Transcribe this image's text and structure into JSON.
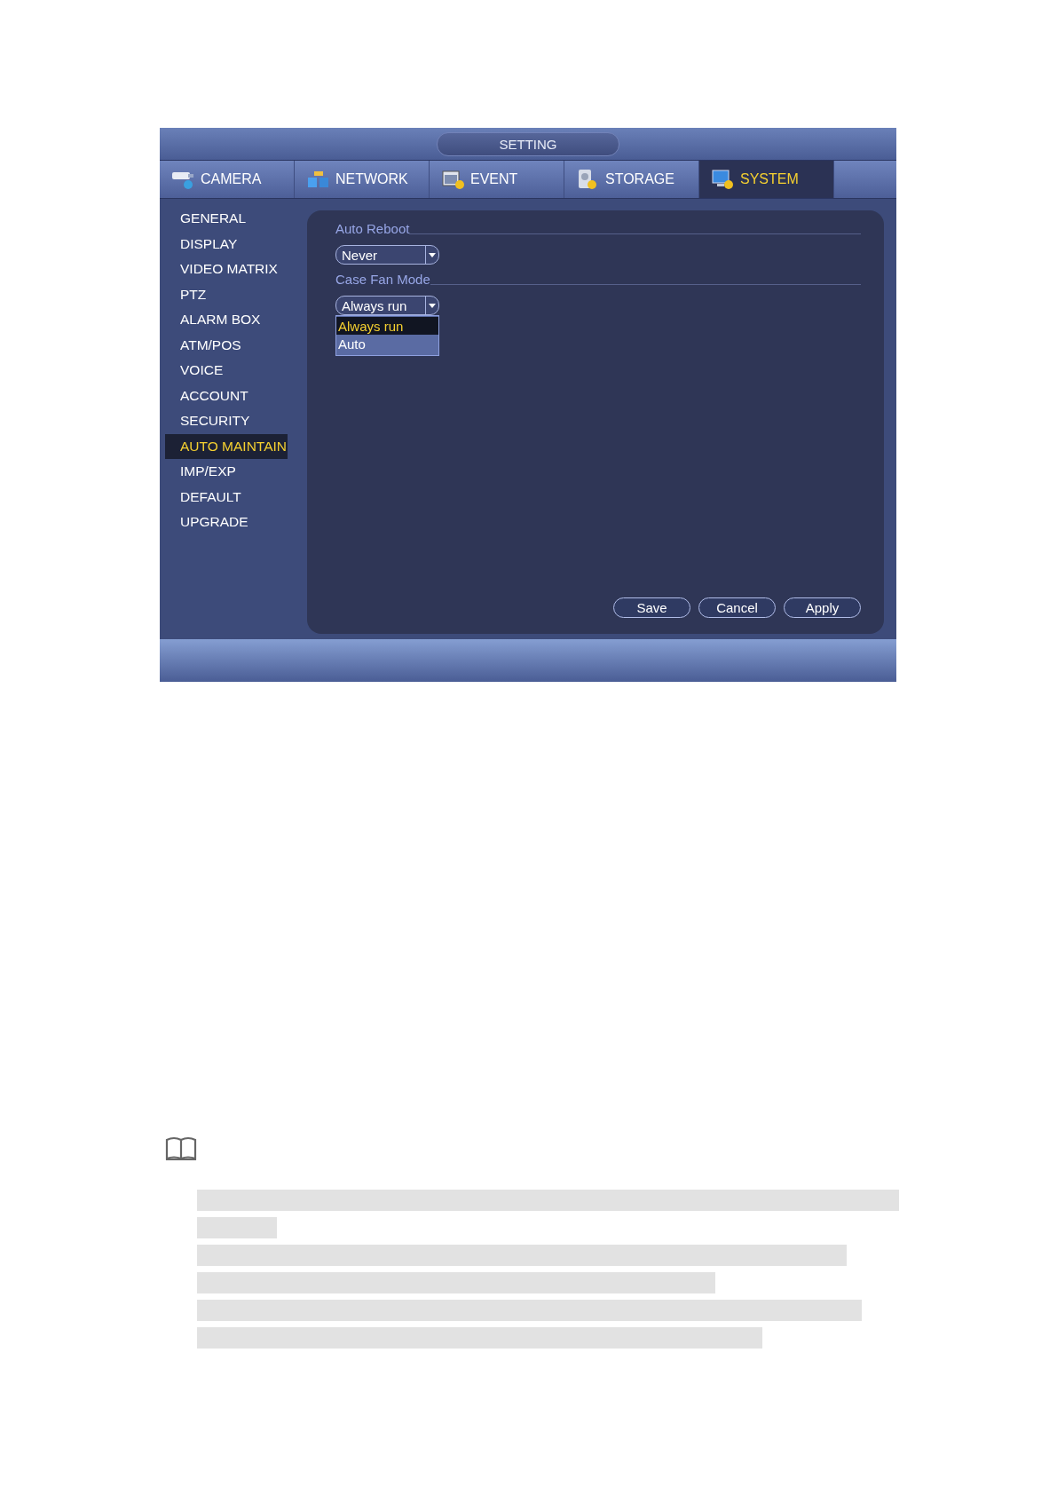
{
  "window": {
    "title": "SETTING"
  },
  "tabs": [
    {
      "label": "CAMERA",
      "selected": false
    },
    {
      "label": "NETWORK",
      "selected": false
    },
    {
      "label": "EVENT",
      "selected": false
    },
    {
      "label": "STORAGE",
      "selected": false
    },
    {
      "label": "SYSTEM",
      "selected": true
    }
  ],
  "sidebar": {
    "items": [
      {
        "label": "GENERAL",
        "selected": false
      },
      {
        "label": "DISPLAY",
        "selected": false
      },
      {
        "label": "VIDEO MATRIX",
        "selected": false
      },
      {
        "label": "PTZ",
        "selected": false
      },
      {
        "label": "ALARM BOX",
        "selected": false
      },
      {
        "label": "ATM/POS",
        "selected": false
      },
      {
        "label": "VOICE",
        "selected": false
      },
      {
        "label": "ACCOUNT",
        "selected": false
      },
      {
        "label": "SECURITY",
        "selected": false
      },
      {
        "label": "AUTO MAINTAIN",
        "selected": true
      },
      {
        "label": "IMP/EXP",
        "selected": false
      },
      {
        "label": "DEFAULT",
        "selected": false
      },
      {
        "label": "UPGRADE",
        "selected": false
      }
    ]
  },
  "sections": [
    {
      "label": "Auto Reboot",
      "dropdown": {
        "value": "Never"
      }
    },
    {
      "label": "Case Fan Mode",
      "dropdown": {
        "value": "Always run",
        "expanded": true,
        "options": [
          {
            "label": "Always run",
            "selected": true
          },
          {
            "label": "Auto",
            "selected": false
          }
        ]
      }
    }
  ],
  "buttons": [
    "Save",
    "Cancel",
    "Apply"
  ]
}
